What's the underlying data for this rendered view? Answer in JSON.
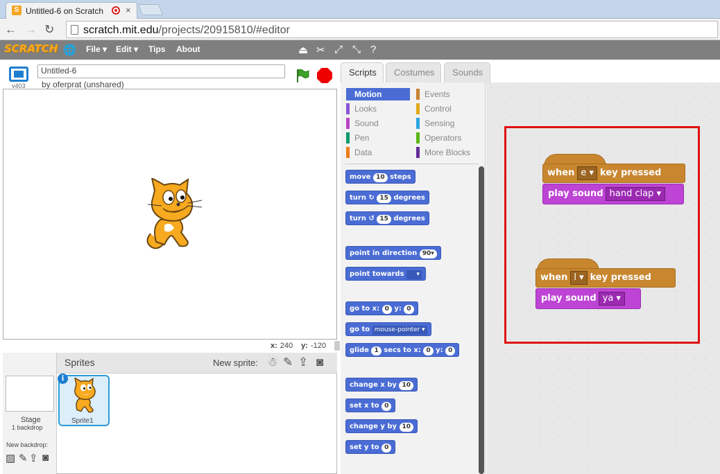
{
  "browser": {
    "tab_title": "Untitled-6 on Scratch",
    "tab_close": "×",
    "favicon": "S",
    "url_host": "scratch.mit.edu",
    "url_path": "/projects/20915810/#editor"
  },
  "menubar": {
    "logo": "SCRATCH",
    "globe_icon": "🌐",
    "items": [
      "File ▾",
      "Edit ▾",
      "Tips",
      "About"
    ]
  },
  "stage": {
    "version": "v403",
    "project_title": "Untitled-6",
    "byline": "by oferprat (unshared)",
    "x_label": "x:",
    "x_value": "240",
    "y_label": "y:",
    "y_value": "-120"
  },
  "sprites": {
    "header": "Sprites",
    "new_sprite_label": "New sprite:",
    "stage_label": "Stage",
    "backdrops_label": "1 backdrop",
    "new_backdrop_label": "New backdrop:",
    "sprite1_name": "Sprite1"
  },
  "tabs": [
    "Scripts",
    "Costumes",
    "Sounds"
  ],
  "categories": {
    "left": [
      "Motion",
      "Looks",
      "Sound",
      "Pen",
      "Data"
    ],
    "right": [
      "Events",
      "Control",
      "Sensing",
      "Operators",
      "More Blocks"
    ],
    "colors": {
      "Motion": "#4a6cd4",
      "Looks": "#8a55d7",
      "Sound": "#bb42c3",
      "Pen": "#0e9a6c",
      "Data": "#ee7d16",
      "Events": "#c88330",
      "Control": "#e1a91a",
      "Sensing": "#2ca5e2",
      "Operators": "#5cb712",
      "More Blocks": "#632d99"
    }
  },
  "palette_blocks": {
    "move": {
      "pre": "move",
      "num": "10",
      "post": "steps"
    },
    "turn_right": {
      "pre": "turn",
      "icon": "↻",
      "num": "15",
      "post": "degrees"
    },
    "turn_left": {
      "pre": "turn",
      "icon": "↺",
      "num": "15",
      "post": "degrees"
    },
    "point_direction": {
      "pre": "point in direction",
      "num": "90▾"
    },
    "point_towards": {
      "pre": "point towards",
      "drop": "▾"
    },
    "goto_xy": {
      "pre": "go to x:",
      "x": "0",
      "mid": "y:",
      "y": "0"
    },
    "goto": {
      "pre": "go to",
      "drop": "mouse-pointer ▾"
    },
    "glide": {
      "pre": "glide",
      "num": "1",
      "mid1": "secs to x:",
      "x": "0",
      "mid2": "y:",
      "y": "0"
    },
    "change_x": {
      "pre": "change x by",
      "num": "10"
    },
    "set_x": {
      "pre": "set x to",
      "num": "0"
    },
    "change_y": {
      "pre": "change y by",
      "num": "10"
    },
    "set_y": {
      "pre": "set y to",
      "num": "0"
    }
  },
  "scripts": [
    {
      "when": "when",
      "key": "e ▾",
      "key_pressed": "key pressed",
      "play": "play sound",
      "sound": "hand clap ▾"
    },
    {
      "when": "when",
      "key": "l ▾",
      "key_pressed": "key pressed",
      "play": "play sound",
      "sound": "ya ▾"
    }
  ]
}
